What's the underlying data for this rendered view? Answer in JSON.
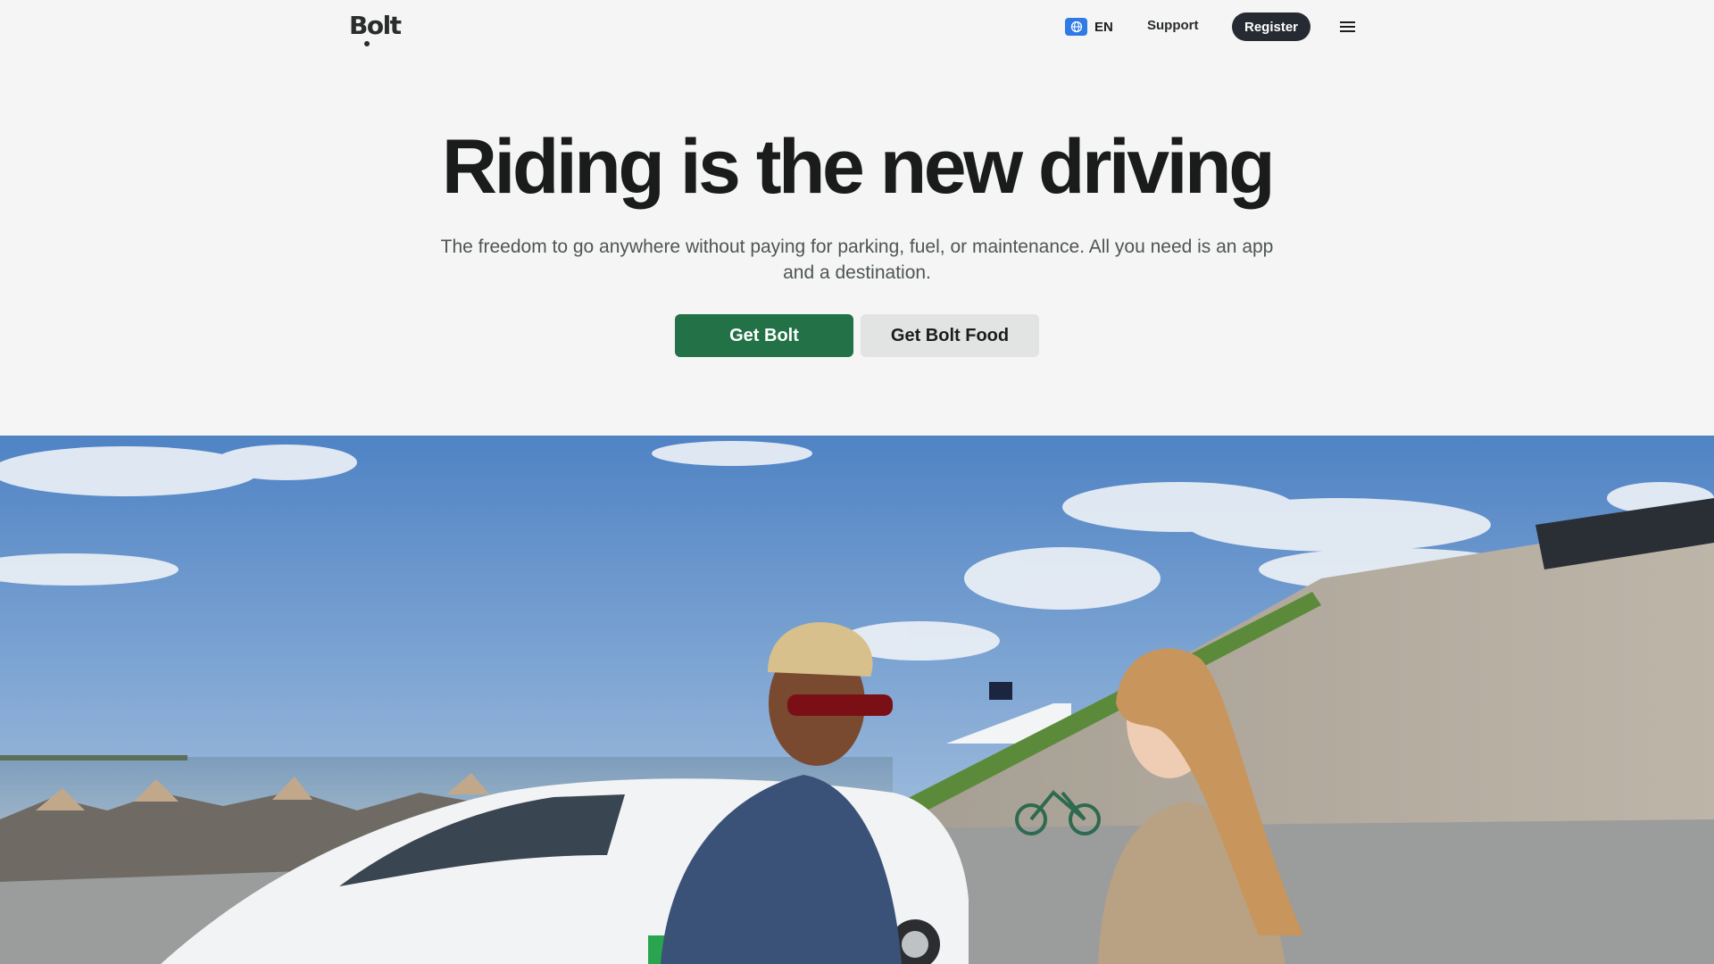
{
  "header": {
    "logo": "Bolt",
    "language": "EN",
    "support_label": "Support",
    "register_label": "Register"
  },
  "hero": {
    "title": "Riding is the new driving",
    "subtitle": "The freedom to go anywhere without paying for parking, fuel, or maintenance. All you need is an app and a destination.",
    "primary_button": "Get Bolt",
    "secondary_button": "Get Bolt Food"
  },
  "colors": {
    "background": "#f4f5f4",
    "brand_green": "#237146",
    "register_bg": "#252a33",
    "secondary_bg": "#e1e4e2"
  },
  "icons": {
    "language": "globe-icon",
    "menu": "hamburger-menu-icon"
  }
}
